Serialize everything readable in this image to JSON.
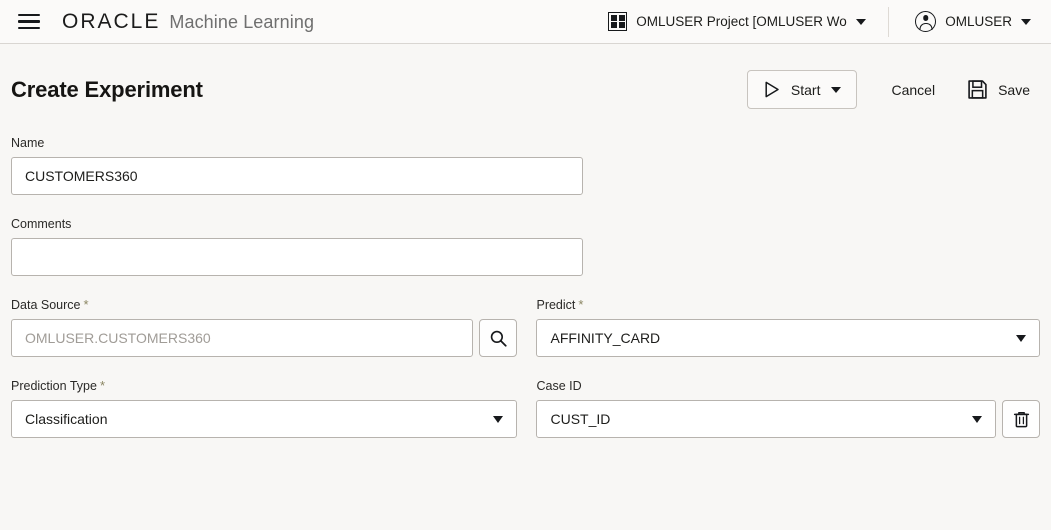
{
  "appbar": {
    "menu_icon": "hamburger-icon",
    "brand": "ORACLE",
    "product": "Machine Learning",
    "project": {
      "icon": "grid-icon",
      "label": "OMLUSER Project [OMLUSER Works...",
      "caret": "chevron-down-icon"
    },
    "user": {
      "icon": "account-circle-icon",
      "label": "OMLUSER",
      "caret": "chevron-down-icon"
    }
  },
  "page": {
    "title": "Create Experiment"
  },
  "toolbar": {
    "start_label": "Start",
    "start_icon": "play-icon",
    "start_caret": "chevron-down-icon",
    "cancel_label": "Cancel",
    "save_label": "Save",
    "save_icon": "floppy-disk-icon"
  },
  "form": {
    "name": {
      "label": "Name",
      "value": "CUSTOMERS360",
      "placeholder": "",
      "required": false
    },
    "comments": {
      "label": "Comments",
      "value": "",
      "placeholder": "",
      "required": false
    },
    "data_source": {
      "label": "Data Source",
      "required": true,
      "required_mark": "*",
      "value": "",
      "placeholder": "OMLUSER.CUSTOMERS360",
      "search_icon": "search-icon"
    },
    "predict": {
      "label": "Predict",
      "required": true,
      "required_mark": "*",
      "value": "AFFINITY_CARD"
    },
    "prediction_type": {
      "label": "Prediction Type",
      "required": true,
      "required_mark": "*",
      "value": "Classification"
    },
    "case_id": {
      "label": "Case ID",
      "required": false,
      "value": "CUST_ID",
      "delete_icon": "trash-icon"
    }
  },
  "colors": {
    "page_background": "#f8f7f5",
    "appbar_background": "#fbfaf9",
    "field_border": "#b7b3ae",
    "text_primary": "#1d1d1b",
    "text_muted": "#6f6f6f",
    "required_asterisk": "#8a8561"
  }
}
